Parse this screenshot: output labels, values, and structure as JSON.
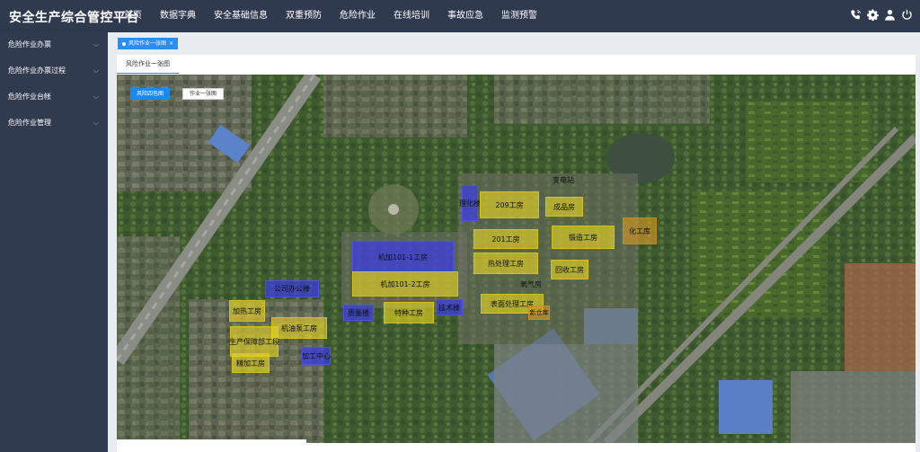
{
  "app": {
    "title": "安全生产综合管控平台"
  },
  "nav": [
    "首页",
    "数据字典",
    "安全基础信息",
    "双重预防",
    "危险作业",
    "在线培训",
    "事故应急",
    "监测预警"
  ],
  "icons": [
    "phone-icon",
    "gear-icon",
    "user-icon",
    "power-icon"
  ],
  "sidebar": {
    "items": [
      {
        "label": "危险作业办票"
      },
      {
        "label": "危险作业办票过程"
      },
      {
        "label": "危险作业台帐"
      },
      {
        "label": "危险作业管理"
      }
    ]
  },
  "tabs": {
    "active": "风险作业一张图"
  },
  "subtab": {
    "label": "风险作业一张图"
  },
  "buttons": {
    "risk_map": "风险四色图",
    "work_map": "作业一张图"
  },
  "colors": {
    "header": "#2f3a4f",
    "sidebar": "#303b50",
    "accent": "#1e88f0",
    "zone_yellow": "#e8d723",
    "zone_blue": "#3c3ce6"
  },
  "zones": [
    {
      "label": "理化楼",
      "color": "blue"
    },
    {
      "label": "209工房",
      "color": "yellow"
    },
    {
      "label": "变电站",
      "color": "none"
    },
    {
      "label": "成品房",
      "color": "yellow"
    },
    {
      "label": "201工房",
      "color": "yellow"
    },
    {
      "label": "锻造工房",
      "color": "yellow"
    },
    {
      "label": "化工库",
      "color": "orange"
    },
    {
      "label": "机加101-1工房",
      "color": "blue"
    },
    {
      "label": "热处理工房",
      "color": "yellow"
    },
    {
      "label": "回收工房",
      "color": "yellow"
    },
    {
      "label": "氧气房",
      "color": "none"
    },
    {
      "label": "机加101-2工房",
      "color": "yellow"
    },
    {
      "label": "公司办公楼",
      "color": "blue"
    },
    {
      "label": "表面处理工房",
      "color": "yellow"
    },
    {
      "label": "新仓库",
      "color": "orange"
    },
    {
      "label": "加热工房",
      "color": "yellow"
    },
    {
      "label": "质量楼",
      "color": "blue"
    },
    {
      "label": "特种工房",
      "color": "yellow"
    },
    {
      "label": "技术楼",
      "color": "blue"
    },
    {
      "label": "机油泵工房",
      "color": "yellow"
    },
    {
      "label": "生产保障部工段",
      "color": "yellow"
    },
    {
      "label": "加工中心",
      "color": "blue"
    },
    {
      "label": "精加工房",
      "color": "yellow"
    }
  ]
}
